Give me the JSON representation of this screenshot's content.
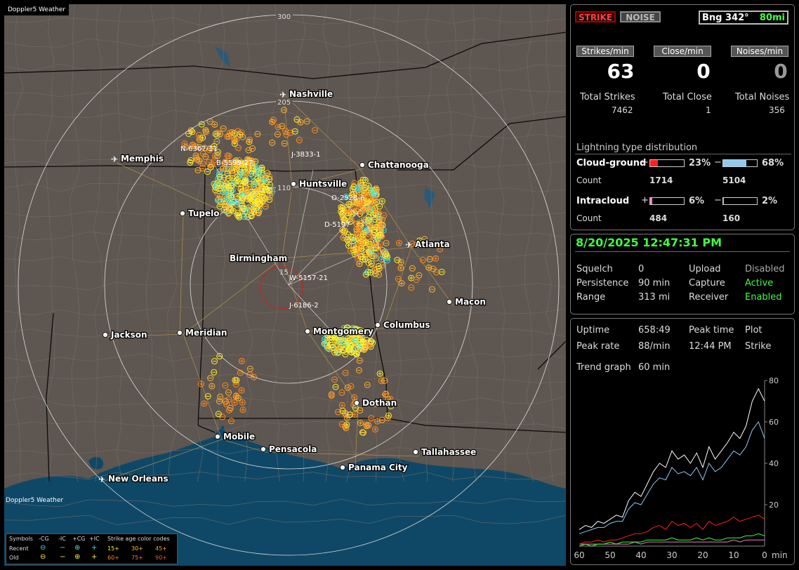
{
  "window": {
    "title": "Doppler5 Weather",
    "watermark": "Doppler5 Weather"
  },
  "map": {
    "range_labels": [
      "300",
      "205",
      "110",
      "15"
    ],
    "cities": [
      {
        "name": "Nashville",
        "type": "airport"
      },
      {
        "name": "Memphis",
        "type": "airport"
      },
      {
        "name": "Chattanooga",
        "type": "city"
      },
      {
        "name": "Huntsville",
        "type": "city"
      },
      {
        "name": "Tupelo",
        "type": "city"
      },
      {
        "name": "Atlanta",
        "type": "airport"
      },
      {
        "name": "Birmingham",
        "type": "city"
      },
      {
        "name": "Macon",
        "type": "city"
      },
      {
        "name": "Jackson",
        "type": "city"
      },
      {
        "name": "Meridian",
        "type": "city"
      },
      {
        "name": "Montgomery",
        "type": "city"
      },
      {
        "name": "Columbus",
        "type": "city"
      },
      {
        "name": "Dothan",
        "type": "city"
      },
      {
        "name": "Mobile",
        "type": "city"
      },
      {
        "name": "Pensacola",
        "type": "city"
      },
      {
        "name": "Tallahassee",
        "type": "city"
      },
      {
        "name": "Panama City",
        "type": "city"
      },
      {
        "name": "New Orleans",
        "type": "airport"
      }
    ],
    "storm_labels": [
      "N-6367-11",
      "B-5599-27",
      "J-3833-1",
      "O-2928-6",
      "D-5197",
      "W-5157-21",
      "J-6186-2"
    ],
    "colors": {
      "land": "#5e5650",
      "water": "#0f4866",
      "ring": "#dddddd",
      "center_ring": "#d02020",
      "county": "#7a706a",
      "state": "#0a0a0a",
      "road": "#b89a50",
      "recent_strike": "#ffee30",
      "old_strike": "#ff9a20",
      "intracloud": "#40e0e0"
    }
  },
  "legend": {
    "header": [
      "Symbols",
      "-CG",
      "-IC",
      "+CG",
      "+IC",
      "Strike age color codes"
    ],
    "recent": {
      "label": "Recent",
      "ages": [
        "15+",
        "30+",
        "45+"
      ]
    },
    "old": {
      "label": "Old",
      "ages": [
        "60+",
        "75+",
        "90+"
      ]
    }
  },
  "panel": {
    "strike_button": "STRIKE",
    "noise_button": "NOISE",
    "bearing": {
      "label": "Bng 342°",
      "range": "80mi"
    },
    "rates": [
      {
        "label": "Strikes/min",
        "value": "63",
        "total_label": "Total Strikes",
        "total": "7462",
        "color": "#ffffff"
      },
      {
        "label": "Close/min",
        "value": "0",
        "total_label": "Total Close",
        "total": "1",
        "color": "#ffffff"
      },
      {
        "label": "Noises/min",
        "value": "0",
        "total_label": "Total Noises",
        "total": "356",
        "color": "#999999"
      }
    ],
    "distribution": {
      "title": "Lightning type distribution",
      "cg_label": "Cloud-ground",
      "ic_label": "Intracloud",
      "count_label": "Count",
      "plus_sign": "+",
      "minus_sign": "−",
      "cg_pos": {
        "pct": "23%",
        "fraction": 0.23,
        "count": "1714",
        "color": "#ff2020"
      },
      "cg_neg": {
        "pct": "68%",
        "fraction": 0.68,
        "count": "5104",
        "color": "#90c8f0"
      },
      "ic_pos": {
        "pct": "6%",
        "fraction": 0.06,
        "count": "484",
        "color": "#f080c0"
      },
      "ic_neg": {
        "pct": "2%",
        "fraction": 0.02,
        "count": "160",
        "color": "#40ff40"
      }
    }
  },
  "status": {
    "datetime": "8/20/2025 12:47:31 PM",
    "squelch_label": "Squelch",
    "squelch": "0",
    "persistence_label": "Persistence",
    "persistence": "90 min",
    "range_label": "Range",
    "range": "313 mi",
    "upload_label": "Upload",
    "upload": "Disabled",
    "capture_label": "Capture",
    "capture": "Active",
    "receiver_label": "Receiver",
    "receiver": "Enabled"
  },
  "stats": {
    "uptime_label": "Uptime",
    "uptime": "658:49",
    "peak_time_label": "Peak time",
    "peak_time": "12:44 PM",
    "plot_label": "Plot",
    "plot": "Strike",
    "peak_rate_label": "Peak rate",
    "peak_rate": "88/min",
    "trend_label": "Trend graph",
    "trend": "60 min"
  },
  "chart_data": {
    "type": "line",
    "title": "",
    "xlabel": "min",
    "ylabel": "",
    "x_ticks": [
      "60",
      "50",
      "40",
      "30",
      "20",
      "10",
      "0"
    ],
    "y_ticks": [
      "20",
      "40",
      "60",
      "80"
    ],
    "xlim": [
      60,
      0
    ],
    "ylim": [
      0,
      80
    ],
    "x": [
      60,
      58,
      56,
      54,
      52,
      50,
      48,
      46,
      44,
      42,
      40,
      38,
      36,
      34,
      32,
      30,
      28,
      26,
      24,
      22,
      20,
      18,
      16,
      14,
      12,
      10,
      8,
      6,
      4,
      2,
      0
    ],
    "series": [
      {
        "color": "#ffffff",
        "values": [
          8,
          10,
          9,
          12,
          11,
          13,
          15,
          14,
          22,
          26,
          24,
          30,
          36,
          40,
          38,
          46,
          42,
          44,
          40,
          45,
          38,
          48,
          42,
          46,
          50,
          55,
          52,
          58,
          70,
          76,
          70
        ]
      },
      {
        "color": "#90c8f0",
        "values": [
          6,
          7,
          8,
          9,
          9,
          11,
          12,
          12,
          18,
          21,
          20,
          25,
          30,
          33,
          32,
          38,
          35,
          36,
          34,
          38,
          32,
          40,
          36,
          38,
          42,
          46,
          44,
          48,
          56,
          60,
          52
        ]
      },
      {
        "color": "#ff2020",
        "values": [
          1,
          2,
          2,
          3,
          2,
          3,
          3,
          4,
          5,
          6,
          6,
          7,
          9,
          10,
          8,
          12,
          10,
          11,
          9,
          11,
          8,
          12,
          10,
          11,
          12,
          14,
          12,
          13,
          14,
          15,
          13
        ]
      },
      {
        "color": "#40ff40",
        "values": [
          1,
          1,
          1,
          1,
          1,
          2,
          1,
          2,
          2,
          2,
          2,
          3,
          3,
          3,
          3,
          4,
          3,
          3,
          3,
          4,
          3,
          4,
          3,
          3,
          4,
          4,
          4,
          5,
          5,
          6,
          5
        ]
      },
      {
        "color": "#f080c0",
        "values": [
          0,
          1,
          0,
          1,
          1,
          1,
          1,
          1,
          1,
          2,
          1,
          2,
          2,
          2,
          2,
          2,
          2,
          2,
          2,
          2,
          2,
          2,
          2,
          2,
          2,
          3,
          2,
          3,
          3,
          3,
          3
        ]
      }
    ]
  }
}
